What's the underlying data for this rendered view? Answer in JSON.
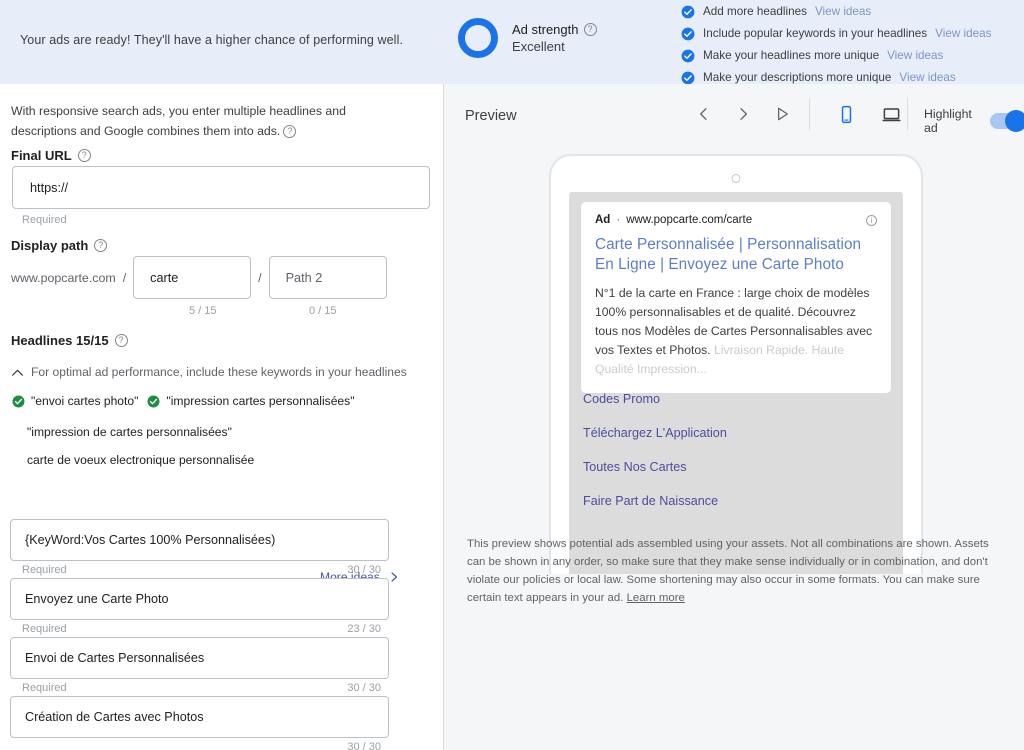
{
  "banner": {
    "message": "Your ads are ready! They'll have a higher chance of performing well.",
    "ad_strength": {
      "label": "Ad strength",
      "value": "Excellent",
      "ring_color": "#1a73e8",
      "help_icon": "help-icon"
    },
    "background_color": "#e8eef9",
    "checklist": [
      {
        "text": "Add more headlines",
        "link": "View ideas",
        "icon": "check-circle-icon"
      },
      {
        "text": "Include popular keywords in your headlines",
        "link": "View ideas",
        "icon": "check-circle-icon"
      },
      {
        "text": "Make your headlines more unique",
        "link": "View ideas",
        "icon": "check-circle-icon"
      },
      {
        "text": "Make your descriptions more unique",
        "link": "View ideas",
        "icon": "check-circle-icon"
      }
    ]
  },
  "form": {
    "intro": "With responsive search ads, you enter multiple headlines and descriptions and Google combines them into ads.",
    "final_url": {
      "label": "Final URL",
      "value": "https://",
      "required_note": "Required"
    },
    "display_path": {
      "label": "Display path",
      "domain": "www.popcarte.com",
      "separator": "/",
      "path1_value": "carte",
      "path1_count": "5 / 15",
      "path2_placeholder": "Path 2",
      "path2_count": "0 / 15"
    },
    "headlines": {
      "label": "Headlines 15/15",
      "keyword_hint": "For optimal ad performance, include these keywords in your headlines",
      "keyword_chips": [
        {
          "text": "\"envoi cartes photo\"",
          "checked": true
        },
        {
          "text": "\"impression cartes personnalisées\"",
          "checked": true
        }
      ],
      "keyword_plain": [
        "\"impression de cartes personnalisées\"",
        "carte de voeux electronique personnalisée"
      ],
      "more_ideas": "More ideas",
      "fields": [
        {
          "value": "{KeyWord:Vos Cartes 100% Personnalisées)",
          "required_note": "Required",
          "count": "30 / 30"
        },
        {
          "value": "Envoyez une Carte Photo",
          "required_note": "Required",
          "count": "23 / 30"
        },
        {
          "value": "Envoi de Cartes Personnalisées",
          "required_note": "Required",
          "count": "30 / 30"
        },
        {
          "value": "Création de Cartes avec Photos",
          "required_note": "",
          "count": "30 / 30"
        }
      ]
    }
  },
  "preview": {
    "title": "Preview",
    "nav": {
      "prev": "chevron-left-icon",
      "next": "chevron-right-icon",
      "play": "play-icon"
    },
    "devices": {
      "mobile": "mobile-device-icon",
      "desktop": "desktop-device-icon",
      "active": "mobile"
    },
    "highlight_toggle": {
      "label": "Highlight ad",
      "on": true,
      "color": "#1a73e8"
    },
    "ad": {
      "badge": "Ad",
      "dot": "·",
      "url": "www.popcarte.com/carte",
      "info_icon": "info-icon",
      "title": "Carte Personnalisée | Personnalisation En Ligne | Envoyez une Carte Photo",
      "description": "N°1 de la carte en France : large choix de modèles 100% personnalisables et de qualité. Découvrez tous nos Modèles de Cartes Personnalisables avec vos Textes et Photos.",
      "description_faded": " Livraison Rapide. Haute Qualité Impression...",
      "sitelinks": [
        "Codes Promo",
        "Téléchargez L'Application",
        "Toutes Nos Cartes",
        "Faire Part de Naissance"
      ]
    },
    "note": "This preview shows potential ads assembled using your assets. Not all combinations are shown. Assets can be shown in any order, so make sure that they make sense individually or in combination, and don't violate our policies or local law. Some shortening may also occur in some formats. You can make sure certain text appears in your ad.",
    "note_link": "Learn more"
  }
}
